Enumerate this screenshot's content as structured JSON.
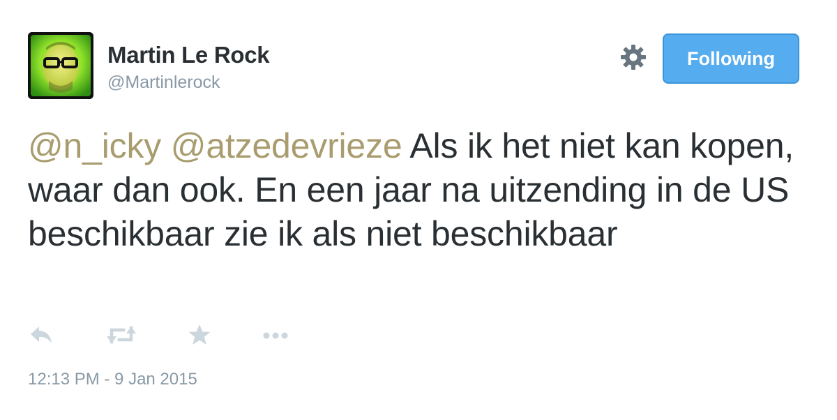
{
  "user": {
    "name": "Martin Le Rock",
    "handle": "@Martinlerock"
  },
  "header": {
    "settings_icon": "gear-icon",
    "follow_button_label": "Following"
  },
  "tweet": {
    "mentions": [
      "@n_icky",
      "@atzedevrieze"
    ],
    "body": "Als ik het niet kan kopen, waar dan ook. En een jaar na uitzending in de US beschikbaar zie ik als niet beschikbaar",
    "timestamp": "12:13 PM - 9 Jan 2015"
  },
  "actions": [
    {
      "icon": "reply-icon"
    },
    {
      "icon": "retweet-icon"
    },
    {
      "icon": "favorite-star-icon"
    },
    {
      "icon": "more-options-icon"
    }
  ],
  "colors": {
    "mention": "#a99c6e",
    "button_bg": "#55acee",
    "muted_text": "#8899a6",
    "action_icon": "#ccd6dd"
  }
}
